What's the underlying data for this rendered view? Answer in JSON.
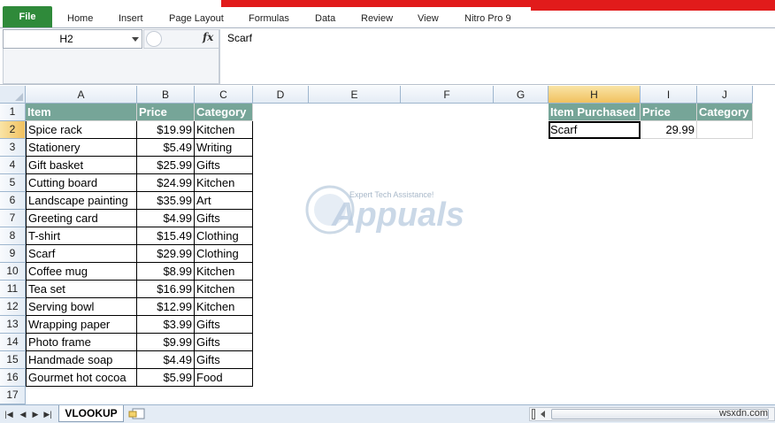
{
  "ribbon": {
    "file_label": "File",
    "tabs": [
      "Home",
      "Insert",
      "Page Layout",
      "Formulas",
      "Data",
      "Review",
      "View",
      "Nitro Pro 9"
    ]
  },
  "formula_bar": {
    "name_box": "H2",
    "fx_label": "fx",
    "content": "Scarf"
  },
  "grid": {
    "columns": [
      "A",
      "B",
      "C",
      "D",
      "E",
      "F",
      "G",
      "H",
      "I",
      "J"
    ],
    "selected_column": "H",
    "selected_row": 2,
    "rows": [
      1,
      2,
      3,
      4,
      5,
      6,
      7,
      8,
      9,
      10,
      11,
      12,
      13,
      14,
      15,
      16,
      17
    ],
    "table_headers": [
      "Item",
      "Price",
      "Category"
    ],
    "table": [
      [
        "Spice rack",
        "$19.99",
        "Kitchen"
      ],
      [
        "Stationery",
        "$5.49",
        "Writing"
      ],
      [
        "Gift basket",
        "$25.99",
        "Gifts"
      ],
      [
        "Cutting board",
        "$24.99",
        "Kitchen"
      ],
      [
        "Landscape painting",
        "$35.99",
        "Art"
      ],
      [
        "Greeting card",
        "$4.99",
        "Gifts"
      ],
      [
        "T-shirt",
        "$15.49",
        "Clothing"
      ],
      [
        "Scarf",
        "$29.99",
        "Clothing"
      ],
      [
        "Coffee mug",
        "$8.99",
        "Kitchen"
      ],
      [
        "Tea set",
        "$16.99",
        "Kitchen"
      ],
      [
        "Serving bowl",
        "$12.99",
        "Kitchen"
      ],
      [
        "Wrapping paper",
        "$3.99",
        "Gifts"
      ],
      [
        "Photo frame",
        "$9.99",
        "Gifts"
      ],
      [
        "Handmade soap",
        "$4.49",
        "Gifts"
      ],
      [
        "Gourmet hot cocoa",
        "$5.99",
        "Food"
      ]
    ],
    "lookup_headers": [
      "Item Purchased",
      "Price",
      "Category"
    ],
    "lookup_values": [
      "Scarf",
      "29.99",
      ""
    ]
  },
  "watermark": {
    "tagline": "Expert Tech Assistance!",
    "brand": "Appuals"
  },
  "sheets": {
    "active": "VLOOKUP"
  },
  "footer_credit": "wsxdn.com",
  "colors": {
    "header_fill": "#76a598",
    "file_tab": "#2f8a3a",
    "selection_header": "#f1c15f"
  }
}
